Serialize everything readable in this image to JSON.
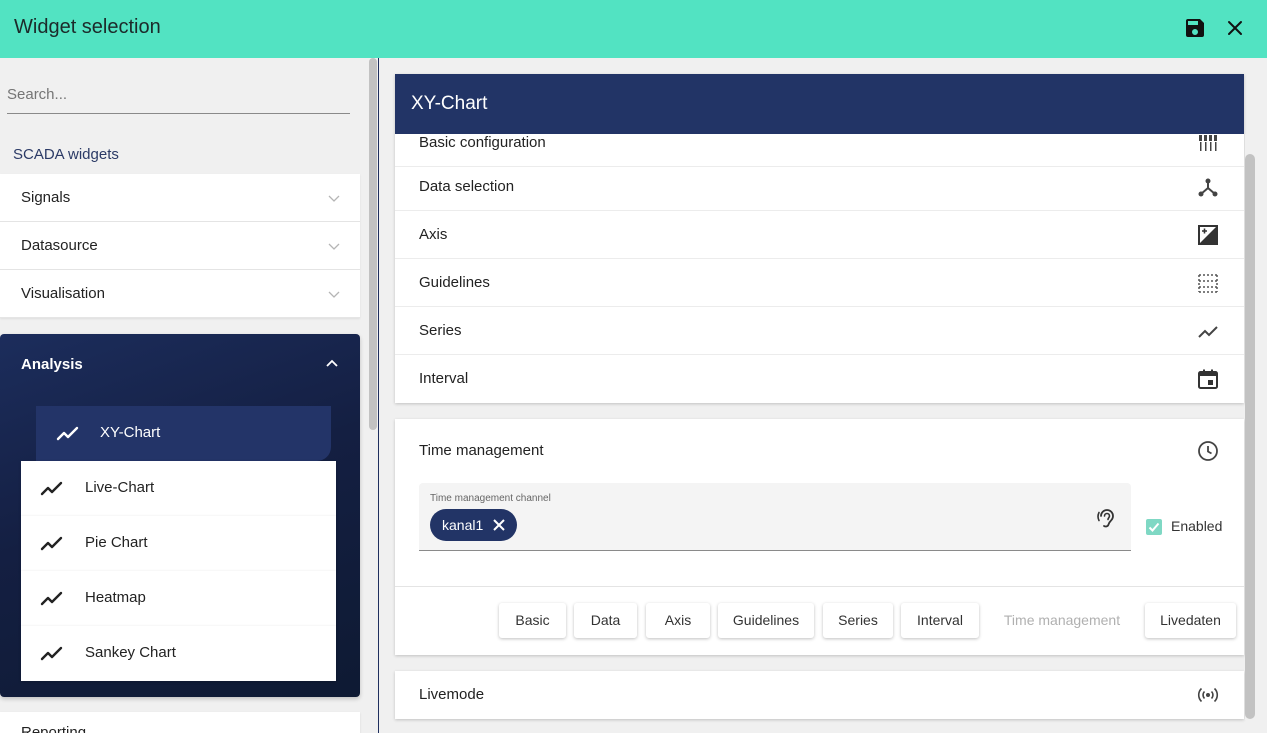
{
  "window": {
    "title": "Widget selection",
    "save_icon": "save-icon",
    "close_icon": "close-icon"
  },
  "left_panel": {
    "search_placeholder": "Search...",
    "section_label": "SCADA widgets",
    "groups": [
      {
        "label": "Signals",
        "expanded": false
      },
      {
        "label": "Datasource",
        "expanded": false
      },
      {
        "label": "Visualisation",
        "expanded": false
      }
    ],
    "analysis": {
      "label": "Analysis",
      "expanded": true,
      "items": [
        {
          "label": "XY-Chart",
          "selected": true,
          "icon": "line-chart-icon"
        },
        {
          "label": "Live-Chart",
          "selected": false,
          "icon": "line-chart-icon"
        },
        {
          "label": "Pie Chart",
          "selected": false,
          "icon": "line-chart-icon"
        },
        {
          "label": "Heatmap",
          "selected": false,
          "icon": "line-chart-icon"
        },
        {
          "label": "Sankey Chart",
          "selected": false,
          "icon": "line-chart-icon"
        }
      ]
    },
    "cutoff_label": "Reporting"
  },
  "right_panel": {
    "widget_title": "XY-Chart",
    "config_rows": [
      {
        "label": "Basic configuration",
        "icon": "sliders-icon"
      },
      {
        "label": "Data selection",
        "icon": "merge-icon"
      },
      {
        "label": "Axis",
        "icon": "contrast-icon"
      },
      {
        "label": "Guidelines",
        "icon": "grid-dots-icon"
      },
      {
        "label": "Series",
        "icon": "trend-icon"
      },
      {
        "label": "Interval",
        "icon": "calendar-icon"
      }
    ],
    "time_management": {
      "title": "Time management",
      "icon": "clock-icon",
      "channel_label": "Time management channel",
      "chip_value": "kanal1",
      "enabled_label": "Enabled",
      "enabled": true
    },
    "nav_buttons": [
      {
        "label": "Basic",
        "disabled": false
      },
      {
        "label": "Data",
        "disabled": false
      },
      {
        "label": "Axis",
        "disabled": false
      },
      {
        "label": "Guidelines",
        "disabled": false
      },
      {
        "label": "Series",
        "disabled": false
      },
      {
        "label": "Interval",
        "disabled": false
      },
      {
        "label": "Time management",
        "disabled": true
      },
      {
        "label": "Livedaten",
        "disabled": false
      }
    ],
    "livemode": {
      "label": "Livemode",
      "icon": "broadcast-icon"
    }
  },
  "colors": {
    "topbar": "#52e3c2",
    "navy": "#223466",
    "checkbox": "#7fd8c4"
  }
}
